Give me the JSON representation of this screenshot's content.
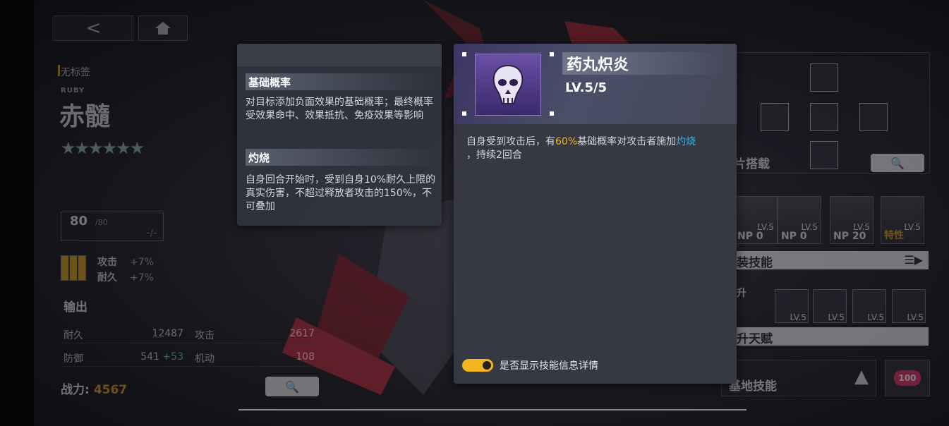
{
  "left": {
    "back_icon": "<",
    "home_icon": "home-icon",
    "tag": "无标签",
    "ruby": "RUBY",
    "char_name": "赤髓",
    "stars": "★★★★★★",
    "level": "80",
    "level_max": "/80",
    "level_dash": "–/–",
    "buffs": [
      {
        "label": "攻击",
        "value": "+7%"
      },
      {
        "label": "耐久",
        "value": "+7%"
      }
    ],
    "section": "输出",
    "stats": [
      {
        "k1": "耐久",
        "v1": "12487",
        "k2": "攻击",
        "v2": "2617"
      },
      {
        "k1": "防御",
        "v1": "541",
        "bonus": "+53",
        "k2": "机动",
        "v2": "108"
      }
    ],
    "power_label": "战力:",
    "power_value": "4567"
  },
  "right": {
    "chip_label": "片搭载",
    "skill_label": "装技能",
    "skills": [
      {
        "np": "NP  0",
        "lv": "LV.5"
      },
      {
        "np": "NP  0",
        "lv": "LV.5"
      },
      {
        "np": "NP 20",
        "lv": "LV.5"
      },
      {
        "np": "特性",
        "lv": "LV.5"
      }
    ],
    "talent_label": "升天赋",
    "talent_side": "升",
    "talents_lv": [
      "LV.5",
      "LV.5",
      "LV.5",
      "LV.5"
    ],
    "base_label": "基地技能",
    "heart": "100"
  },
  "tooltip": {
    "term1": "基础概率",
    "desc1": "对目标添加负面效果的基础概率；最终概率受效果命中、效果抵抗、免疫效果等影响",
    "term2": "灼烧",
    "desc2": "自身回合开始时，受到自身10%耐久上限的真实伤害，不超过释放者攻击的150%，不可叠加"
  },
  "skill": {
    "name": "药丸炽炎",
    "level": "LV.5/5",
    "desc_a": "自身受到攻击后，有",
    "desc_pct": "60%",
    "desc_b": "基础概率",
    "desc_c": "对攻击者施加",
    "desc_burn": "灼烧",
    "desc_d": "，持续2回合",
    "toggle_label": "是否显示技能信息详情",
    "toggle_on": true
  },
  "colors": {
    "highlight_yellow": "#f3b41c",
    "highlight_blue": "#33b7f0",
    "accent": "#d9a21a"
  }
}
